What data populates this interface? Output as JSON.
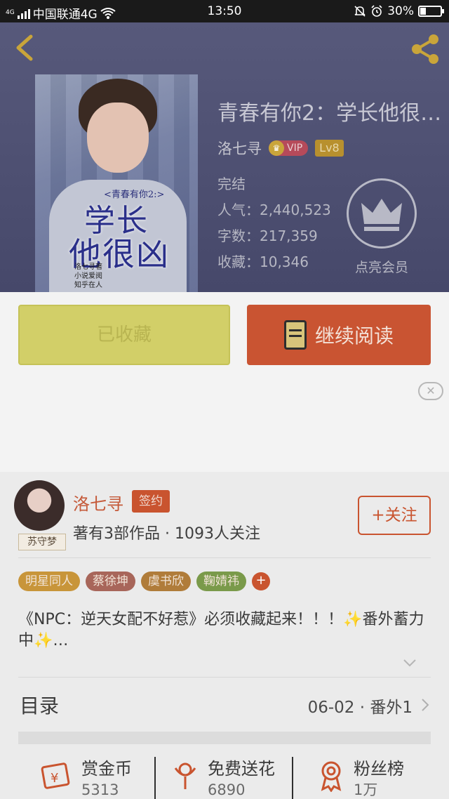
{
  "status_bar": {
    "carrier": "中国联通4G",
    "signal_tag": "4G",
    "time": "13:50",
    "battery": "30%",
    "battery_level": 0.3
  },
  "book": {
    "title": "青春有你2：学长他很…",
    "author": "洛七寻",
    "vip_label": "VIP",
    "level": "Lv8",
    "status": "完结",
    "popularity": "人气：2,440,523",
    "word_count": "字数：217,359",
    "favorites": "收藏：10,346",
    "member_label": "点亮会员",
    "cover": {
      "tag_text": "<青春有你2:>",
      "line1": "学长",
      "line2": "他很凶",
      "small_text": "洛七寻著\n小说爱阅\n知乎在人"
    }
  },
  "actions": {
    "favorited_label": "已收藏",
    "continue_label": "继续阅读"
  },
  "ad": {
    "close_label": "✕"
  },
  "author_card": {
    "name": "洛七寻",
    "signed_label": "签约",
    "avatar_tag": "苏守梦",
    "summary": "著有3部作品 · 1093人关注",
    "follow_label": "+关注",
    "tags": [
      {
        "label": "明星同人",
        "color": "#c8953a"
      },
      {
        "label": "蔡徐坤",
        "color": "#a8665a"
      },
      {
        "label": "虞书欣",
        "color": "#b07c3a"
      },
      {
        "label": "鞠婧祎",
        "color": "#7a9a4a"
      }
    ],
    "tags_more": "+",
    "intro": "《NPC：逆天女配不好惹》必须收藏起来！！！✨番外蓄力中✨…"
  },
  "toc": {
    "label": "目录",
    "latest": "06-02 · 番外1"
  },
  "rewards": [
    {
      "label": "赏金币",
      "value": "5313"
    },
    {
      "label": "免费送花",
      "value": "6890"
    },
    {
      "label": "粉丝榜",
      "value": "1万"
    }
  ],
  "colors": {
    "accent": "#c9542f",
    "header_bg": "#4f5173",
    "fav_button": "#d2cf68"
  }
}
